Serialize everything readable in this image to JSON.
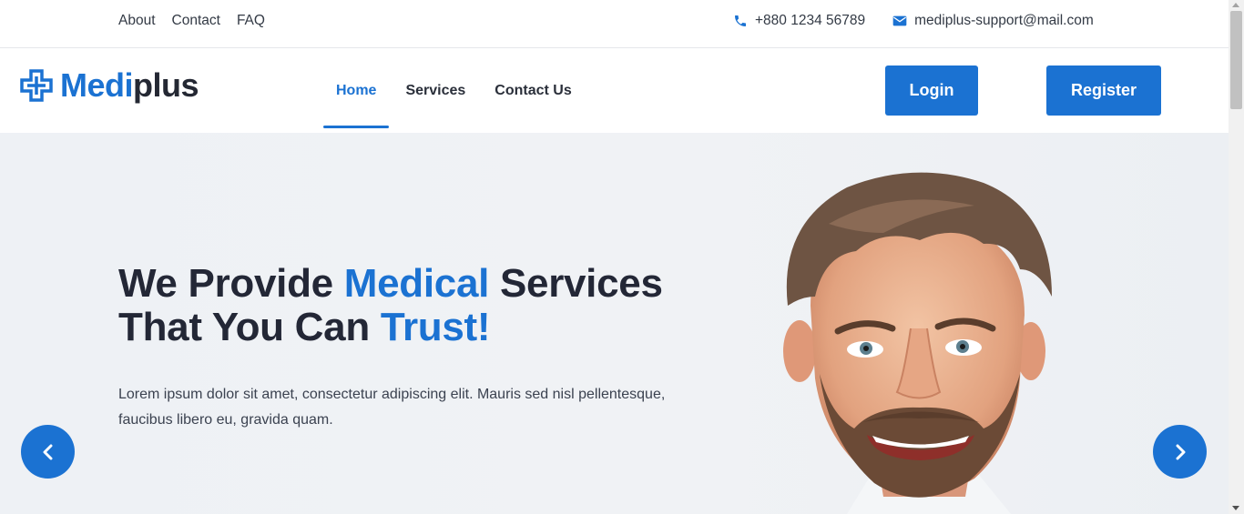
{
  "topbar": {
    "links": [
      "About",
      "Contact",
      "FAQ"
    ],
    "phone": "+880 1234 56789",
    "email": "mediplus-support@mail.com"
  },
  "brand": {
    "part1": "Medi",
    "part2": "plus",
    "accent_color": "#1b72d2"
  },
  "nav": {
    "items": [
      {
        "label": "Home",
        "active": true
      },
      {
        "label": "Services",
        "active": false
      },
      {
        "label": "Contact Us",
        "active": false
      }
    ],
    "login_label": "Login",
    "register_label": "Register"
  },
  "hero": {
    "title_line1_a": "We Provide ",
    "title_line1_accent": "Medical",
    "title_line1_b": " Services",
    "title_line2_a": "That You Can ",
    "title_line2_accent": "Trust!",
    "description": "Lorem ipsum dolor sit amet, consectetur adipiscing elit. Mauris sed nisl pellentesque, faucibus libero eu, gravida quam."
  },
  "icons": {
    "phone": "phone-icon",
    "email": "envelope-icon",
    "prev": "chevron-left-icon",
    "next": "chevron-right-icon"
  }
}
